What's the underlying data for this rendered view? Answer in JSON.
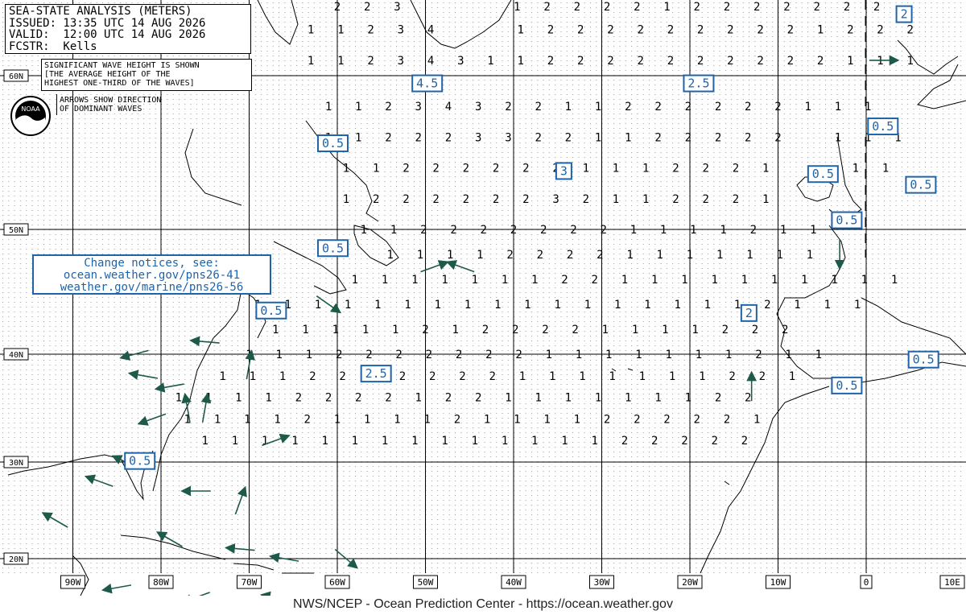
{
  "header": {
    "title": "SEA-STATE ANALYSIS (METERS)",
    "issued": "ISSUED: 13:35 UTC 14 AUG 2026",
    "valid": "VALID:  12:00 UTC 14 AUG 2026",
    "forecaster": "FCSTR:  Kells"
  },
  "notes": {
    "wave_lines": [
      "SIGNIFICANT WAVE HEIGHT IS SHOWN",
      "[THE AVERAGE HEIGHT OF THE",
      "HIGHEST ONE-THIRD OF THE WAVES]"
    ],
    "arrow_lines": [
      "ARROWS SHOW DIRECTION",
      "OF DOMINANT WAVES"
    ]
  },
  "logo": {
    "text": "NOAA",
    "icon": "noaa-logo-icon"
  },
  "change_notice": {
    "line1": "Change notices, see:",
    "line2": "ocean.weather.gov/pns26-41",
    "line3": "weather.gov/marine/pns26-56"
  },
  "footer": "NWS/NCEP - Ocean Prediction Center - https://ocean.weather.gov",
  "colors": {
    "box": "#1f63a8",
    "arrow": "#1d5a4a",
    "land": "#000000",
    "grid": "#000000"
  },
  "lon_labels": [
    "90W",
    "80W",
    "70W",
    "60W",
    "50W",
    "40W",
    "30W",
    "20W",
    "10W",
    "0",
    "10E"
  ],
  "lat_labels": [
    "60N",
    "50N",
    "40N",
    "30N",
    "20N"
  ],
  "contour_labels": [
    {
      "t": "4.5",
      "lon": -49.8,
      "lat": 59.5
    },
    {
      "t": "2.5",
      "lon": -19.0,
      "lat": 59.5
    },
    {
      "t": "2",
      "lon": 4.3,
      "lat": 64.0
    },
    {
      "t": "0.5",
      "lon": -60.5,
      "lat": 55.6
    },
    {
      "t": "0.5",
      "lon": 1.9,
      "lat": 56.7
    },
    {
      "t": "3",
      "lon": -34.3,
      "lat": 53.8
    },
    {
      "t": "0.5",
      "lon": -4.9,
      "lat": 53.6
    },
    {
      "t": "0.5",
      "lon": 6.2,
      "lat": 52.9
    },
    {
      "t": "0.5",
      "lon": -2.2,
      "lat": 50.6
    },
    {
      "t": "0.5",
      "lon": -60.5,
      "lat": 48.5
    },
    {
      "t": "0.5",
      "lon": -67.5,
      "lat": 43.5
    },
    {
      "t": "2",
      "lon": -13.3,
      "lat": 43.3
    },
    {
      "t": "0.5",
      "lon": 6.5,
      "lat": 39.5
    },
    {
      "t": "2.5",
      "lon": -55.6,
      "lat": 38.2
    },
    {
      "t": "0.5",
      "lon": -2.2,
      "lat": 37.1
    },
    {
      "t": "0.5",
      "lon": -82.4,
      "lat": 30.1
    }
  ],
  "wave_rows": [
    {
      "lat": 64.5,
      "lon0": -60,
      "vals": [
        "2",
        "2",
        "3",
        "",
        "",
        "",
        "1",
        "2",
        "2",
        "2",
        "2",
        "1",
        "2",
        "2",
        "2",
        "2",
        "2",
        "2",
        "2"
      ]
    },
    {
      "lat": 63.0,
      "lon0": -63,
      "vals": [
        "1",
        "1",
        "2",
        "3",
        "4",
        "",
        "",
        "1",
        "2",
        "2",
        "2",
        "2",
        "2",
        "2",
        "2",
        "2",
        "2",
        "1",
        "2",
        "2",
        "2"
      ]
    },
    {
      "lat": 61.0,
      "lon0": -63,
      "vals": [
        "1",
        "1",
        "2",
        "3",
        "4",
        "3",
        "1",
        "1",
        "2",
        "2",
        "2",
        "2",
        "2",
        "2",
        "2",
        "2",
        "2",
        "2",
        "1",
        "1",
        "1"
      ]
    },
    {
      "lat": 58.0,
      "lon0": -61,
      "vals": [
        "1",
        "1",
        "2",
        "3",
        "4",
        "3",
        "2",
        "2",
        "1",
        "1",
        "2",
        "2",
        "2",
        "2",
        "2",
        "2",
        "1",
        "1",
        "1"
      ]
    },
    {
      "lat": 56.0,
      "lon0": -61,
      "vals": [
        "1",
        "1",
        "2",
        "2",
        "2",
        "3",
        "3",
        "2",
        "2",
        "1",
        "1",
        "2",
        "2",
        "2",
        "2",
        "2",
        "",
        "1",
        "1",
        "1"
      ]
    },
    {
      "lat": 54.0,
      "lon0": -59,
      "vals": [
        "1",
        "1",
        "2",
        "2",
        "2",
        "2",
        "2",
        "2",
        "1",
        "1",
        "1",
        "2",
        "2",
        "2",
        "1",
        "",
        "",
        "1",
        "1"
      ]
    },
    {
      "lat": 52.0,
      "lon0": -59,
      "vals": [
        "1",
        "2",
        "2",
        "2",
        "2",
        "2",
        "2",
        "3",
        "2",
        "1",
        "1",
        "2",
        "2",
        "2",
        "1"
      ]
    },
    {
      "lat": 50.0,
      "lon0": -57,
      "vals": [
        "1",
        "1",
        "2",
        "2",
        "2",
        "2",
        "2",
        "2",
        "2",
        "1",
        "1",
        "1",
        "1",
        "2",
        "1",
        "1"
      ]
    },
    {
      "lat": 48.0,
      "lon0": -54,
      "vals": [
        "1",
        "1",
        "1",
        "1",
        "2",
        "2",
        "2",
        "2",
        "1",
        "1",
        "1",
        "1",
        "1",
        "1",
        "1"
      ]
    },
    {
      "lat": 46.0,
      "lon0": -58,
      "vals": [
        "1",
        "1",
        "1",
        "1",
        "1",
        "1",
        "1",
        "2",
        "2",
        "1",
        "1",
        "1",
        "1",
        "1",
        "1",
        "1",
        "1",
        "1",
        "1"
      ]
    },
    {
      "lat": 44.0,
      "lon0": -69,
      "vals": [
        "1",
        "1",
        "1",
        "1",
        "1",
        "1",
        "1",
        "1",
        "1",
        "1",
        "1",
        "1",
        "1",
        "1",
        "1",
        "1",
        "1",
        "2",
        "1",
        "1",
        "1"
      ]
    },
    {
      "lat": 42.0,
      "lon0": -67,
      "vals": [
        "1",
        "1",
        "1",
        "1",
        "1",
        "2",
        "1",
        "2",
        "2",
        "2",
        "2",
        "1",
        "1",
        "1",
        "1",
        "2",
        "2",
        "2"
      ]
    },
    {
      "lat": 40.0,
      "lon0": -70,
      "vals": [
        "1",
        "1",
        "1",
        "2",
        "2",
        "2",
        "2",
        "2",
        "2",
        "2",
        "1",
        "1",
        "1",
        "1",
        "1",
        "1",
        "1",
        "2",
        "1",
        "1"
      ]
    },
    {
      "lat": 38.0,
      "lon0": -73,
      "vals": [
        "1",
        "1",
        "1",
        "2",
        "2",
        "2",
        "2",
        "2",
        "2",
        "2",
        "1",
        "1",
        "1",
        "1",
        "1",
        "1",
        "1",
        "2",
        "2",
        "1"
      ]
    },
    {
      "lat": 36.0,
      "lon0": -78,
      "vals": [
        "1",
        "1",
        "1",
        "1",
        "2",
        "2",
        "2",
        "2",
        "1",
        "2",
        "2",
        "1",
        "1",
        "1",
        "1",
        "1",
        "1",
        "1",
        "2",
        "2"
      ]
    },
    {
      "lat": 34.0,
      "lon0": -77,
      "vals": [
        "1",
        "1",
        "1",
        "1",
        "2",
        "1",
        "1",
        "1",
        "1",
        "2",
        "1",
        "1",
        "1",
        "1",
        "2",
        "2",
        "2",
        "2",
        "2",
        "1"
      ]
    },
    {
      "lat": 32.0,
      "lon0": -75,
      "vals": [
        "1",
        "1",
        "1",
        "1",
        "1",
        "1",
        "1",
        "1",
        "1",
        "1",
        "1",
        "1",
        "1",
        "1",
        "2",
        "2",
        "2",
        "2",
        "2"
      ]
    }
  ],
  "arrows": [
    {
      "lon": 2,
      "lat": 61,
      "a": 0
    },
    {
      "lon": -13,
      "lat": 37,
      "a": 90
    },
    {
      "lon": -3,
      "lat": 48,
      "a": -90
    },
    {
      "lon": -49,
      "lat": 47,
      "a": 20
    },
    {
      "lon": -46,
      "lat": 47,
      "a": 160
    },
    {
      "lon": -61,
      "lat": 44,
      "a": -35
    },
    {
      "lon": -83,
      "lat": 40,
      "a": 195
    },
    {
      "lon": -75,
      "lat": 41,
      "a": 175
    },
    {
      "lon": -82,
      "lat": 38,
      "a": 170
    },
    {
      "lon": -79,
      "lat": 37,
      "a": 190
    },
    {
      "lon": -77,
      "lat": 35,
      "a": 100
    },
    {
      "lon": -75,
      "lat": 35,
      "a": 80
    },
    {
      "lon": -70,
      "lat": 39,
      "a": 80
    },
    {
      "lon": -67,
      "lat": 32,
      "a": 20
    },
    {
      "lon": -81,
      "lat": 34,
      "a": 200
    },
    {
      "lon": -84,
      "lat": 30,
      "a": 155
    },
    {
      "lon": -87,
      "lat": 28,
      "a": 160
    },
    {
      "lon": -71,
      "lat": 26,
      "a": 70
    },
    {
      "lon": -76,
      "lat": 27,
      "a": 180
    },
    {
      "lon": -79,
      "lat": 22,
      "a": 150
    },
    {
      "lon": -71,
      "lat": 21,
      "a": 175
    },
    {
      "lon": -59,
      "lat": 20,
      "a": -40
    },
    {
      "lon": -85,
      "lat": 17,
      "a": 190
    },
    {
      "lon": -76,
      "lat": 16,
      "a": 200
    },
    {
      "lon": -66,
      "lat": 20,
      "a": 170
    },
    {
      "lon": -92,
      "lat": 24,
      "a": 150
    },
    {
      "lon": -67,
      "lat": 16,
      "a": 170
    }
  ]
}
